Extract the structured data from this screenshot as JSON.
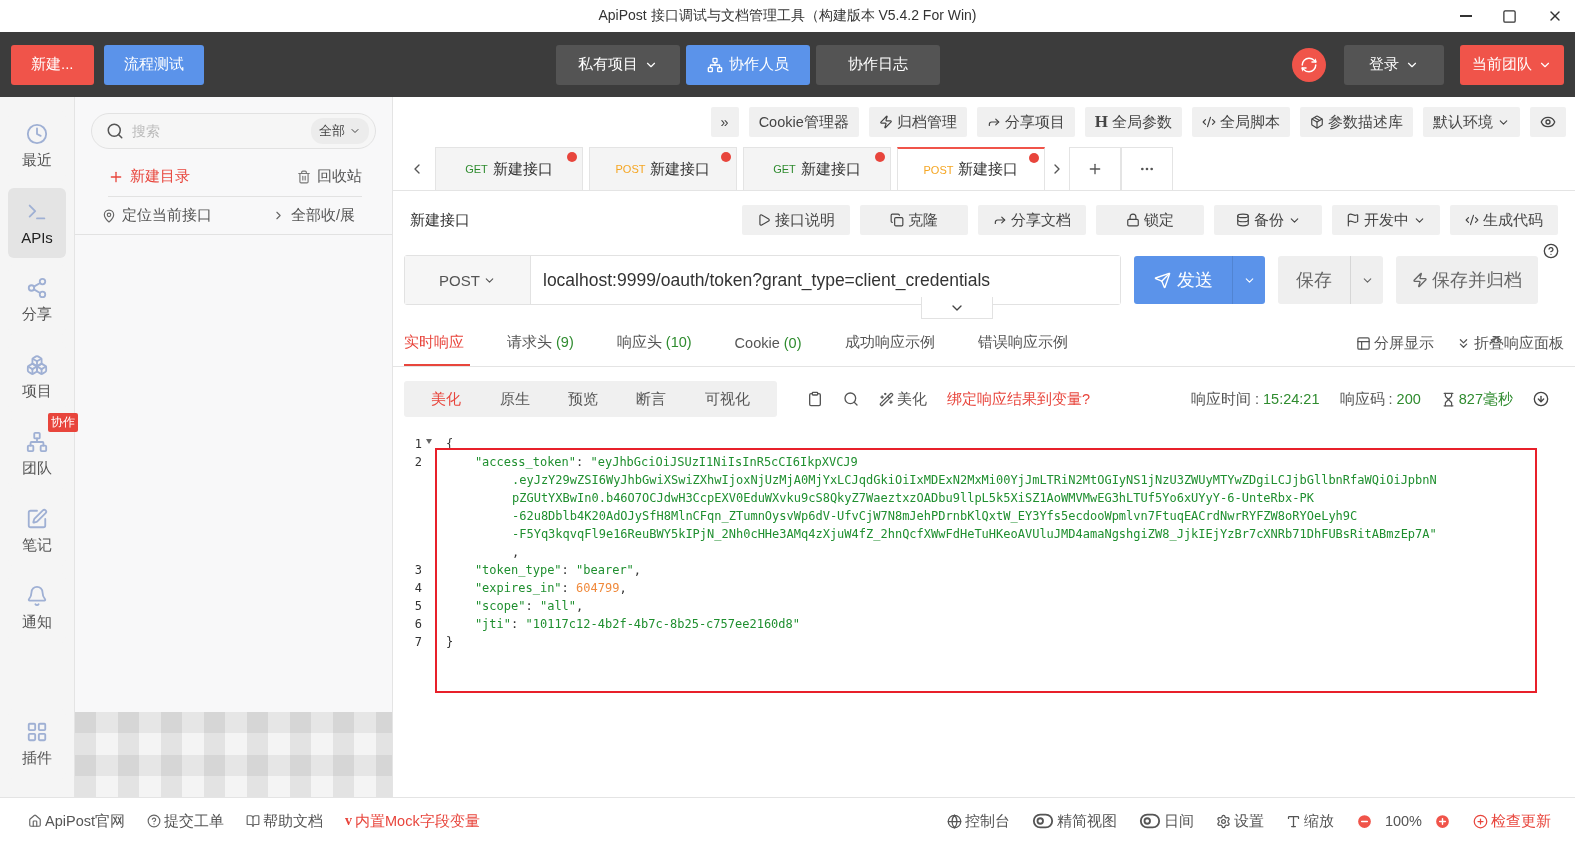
{
  "window": {
    "title": "ApiPost 接口调试与文档管理工具（构建版本 V5.4.2 For Win)"
  },
  "topbar": {
    "left": [
      {
        "label": "新建...",
        "kind": "danger"
      },
      {
        "label": "流程测试",
        "kind": "primary"
      }
    ],
    "center": [
      {
        "label": "私有项目",
        "dropdown": true,
        "selected": false
      },
      {
        "label": "协作人员",
        "dropdown": false,
        "selected": true
      },
      {
        "label": "协作日志",
        "dropdown": false,
        "selected": false
      }
    ],
    "login": "登录",
    "team": "当前团队"
  },
  "rail": [
    {
      "label": "最近",
      "selected": false
    },
    {
      "label": "APIs",
      "selected": true
    },
    {
      "label": "分享",
      "selected": false
    },
    {
      "label": "项目",
      "selected": false
    },
    {
      "label": "团队",
      "selected": false,
      "badge": "协作"
    },
    {
      "label": "笔记",
      "selected": false
    },
    {
      "label": "通知",
      "selected": false
    },
    {
      "label": "插件",
      "selected": false
    }
  ],
  "panel": {
    "search": {
      "placeholder": "搜索",
      "scope": "全部"
    },
    "new_folder": "新建目录",
    "recycle": "回收站",
    "locate": "定位当前接口",
    "collapse": "全部收/展"
  },
  "toolbar": [
    {
      "label": "»"
    },
    {
      "label": "Cookie管理器"
    },
    {
      "label": "归档管理"
    },
    {
      "label": "分享项目"
    },
    {
      "label": "全局参数",
      "glyph": "H"
    },
    {
      "label": "全局脚本"
    },
    {
      "label": "参数描述库"
    },
    {
      "label": "默认环境",
      "dropdown": true
    }
  ],
  "tabs": [
    {
      "method": "GET",
      "kind": "get",
      "label": "新建接口",
      "selected": false,
      "unsaved": true
    },
    {
      "method": "POST",
      "kind": "post",
      "label": "新建接口",
      "selected": false,
      "unsaved": true
    },
    {
      "method": "GET",
      "kind": "get",
      "label": "新建接口",
      "selected": false,
      "unsaved": true
    },
    {
      "method": "POST",
      "kind": "post",
      "label": "新建接口",
      "selected": true,
      "unsaved": true
    }
  ],
  "request": {
    "name": "新建接口",
    "actions": [
      {
        "label": "接口说明"
      },
      {
        "label": "克隆"
      },
      {
        "label": "分享文档"
      },
      {
        "label": "锁定"
      },
      {
        "label": "备份",
        "dropdown": true
      },
      {
        "label": "开发中",
        "dropdown": true
      },
      {
        "label": "生成代码"
      }
    ],
    "method": "POST",
    "url": "localhost:9999/oauth/token?grant_type=client_credentials",
    "send": "发送",
    "save": "保存",
    "save_archive": "保存并归档"
  },
  "response": {
    "tabs": [
      {
        "label": "实时响应",
        "selected": true
      },
      {
        "label": "请求头",
        "count": "(9)",
        "selected": false
      },
      {
        "label": "响应头",
        "count": "(10)",
        "selected": false
      },
      {
        "label": "Cookie",
        "count": "(0)",
        "selected": false
      },
      {
        "label": "成功响应示例",
        "selected": false
      },
      {
        "label": "错误响应示例",
        "selected": false
      }
    ],
    "split": "分屏显示",
    "fold": "折叠响应面板",
    "views": [
      {
        "label": "美化",
        "selected": true
      },
      {
        "label": "原生",
        "selected": false
      },
      {
        "label": "预览",
        "selected": false
      },
      {
        "label": "断言",
        "selected": false
      },
      {
        "label": "可视化",
        "selected": false
      }
    ],
    "beautify": "美化",
    "bind": "绑定响应结果到变量?",
    "time_label": "响应时间 :",
    "time": "15:24:21",
    "code_label": "响应码 :",
    "code": "200",
    "duration": "827毫秒"
  },
  "code": [
    {
      "number": "1",
      "tokens": [
        {
          "kind": "punct",
          "text": "{"
        }
      ],
      "fold": true
    },
    {
      "number": "2",
      "tokens": [
        {
          "kind": "key",
          "text": "    \"access_token\""
        },
        {
          "kind": "punct",
          "text": ": "
        },
        {
          "kind": "string",
          "text": "\"eyJhbGciOiJSUzI1NiIsInR5cCI6IkpXVCJ9"
        }
      ],
      "wrap": [
        {
          "kind": "string",
          "text": ".eyJzY29wZSI6WyJhbGwiXSwiZXhwIjoxNjUzMjA0MjYxLCJqdGkiOiIxMDExN2MxMi00YjJmLTRiN2MtOGIyNS1jNzU3ZWUyMTYwZDgiLCJjbGllbnRfaWQiOiJpbnN"
        },
        {
          "kind": "string",
          "text": "pZGUtYXBwIn0.b46O7OCJdwH3CcpEXV0EduWXvku9cS8QkyZ7WaeztxzOADbu9llpL5k5XiSZ1AoWMVMwEG3hLTUf5Yo6xUYyY-6-UnteRbx-PK"
        },
        {
          "kind": "string",
          "text": "-62u8Dblb4K20AdOJySfH8MlnCFqn_ZTumnOysvWp6dV-UfvCjW7N8mJehPDrnbKlQxtW_EY3Yfs5ecdooWpmlvn7FtuqEACrdNwrRYFZW8oRYOeLyh9C"
        },
        {
          "kind": "string",
          "text": "-F5Yq3kqvqFl9e16ReuBWY5kIPjN_2Nh0cHHe3AMq4zXjuW4fZ_2hnQcfXWwFdHeTuHKeoAVUluJMD4amaNgshgiZW8_JjkIEjYzBr7cXNRb71DhFUBsRitABmzEp7A\""
        },
        {
          "kind": "punct",
          "text": ","
        }
      ]
    },
    {
      "number": "3",
      "tokens": [
        {
          "kind": "key",
          "text": "    \"token_type\""
        },
        {
          "kind": "punct",
          "text": ": "
        },
        {
          "kind": "string",
          "text": "\"bearer\""
        },
        {
          "kind": "punct",
          "text": ","
        }
      ]
    },
    {
      "number": "4",
      "tokens": [
        {
          "kind": "key",
          "text": "    \"expires_in\""
        },
        {
          "kind": "punct",
          "text": ": "
        },
        {
          "kind": "number",
          "text": "604799"
        },
        {
          "kind": "punct",
          "text": ","
        }
      ]
    },
    {
      "number": "5",
      "tokens": [
        {
          "kind": "key",
          "text": "    \"scope\""
        },
        {
          "kind": "punct",
          "text": ": "
        },
        {
          "kind": "string",
          "text": "\"all\""
        },
        {
          "kind": "punct",
          "text": ","
        }
      ]
    },
    {
      "number": "6",
      "tokens": [
        {
          "kind": "key",
          "text": "    \"jti\""
        },
        {
          "kind": "punct",
          "text": ": "
        },
        {
          "kind": "string",
          "text": "\"10117c12-4b2f-4b7c-8b25-c757ee2160d8\""
        }
      ]
    },
    {
      "number": "7",
      "tokens": [
        {
          "kind": "punct",
          "text": "}"
        }
      ]
    }
  ],
  "status": {
    "left": [
      {
        "label": "ApiPost官网",
        "kind": "plain"
      },
      {
        "label": "提交工单",
        "kind": "plain"
      },
      {
        "label": "帮助文档",
        "kind": "plain"
      },
      {
        "label": "内置Mock字段变量",
        "kind": "alert",
        "glyph": "v"
      }
    ],
    "right": [
      {
        "label": "控制台",
        "kind": "plain"
      },
      {
        "label": "精简视图",
        "kind": "toggle",
        "on": false
      },
      {
        "label": "日间",
        "kind": "toggle",
        "on": false
      },
      {
        "label": "设置",
        "kind": "plain"
      },
      {
        "label": "缩放",
        "kind": "plain"
      },
      {
        "label": "100%",
        "kind": "zoom"
      },
      {
        "label": "检查更新",
        "kind": "alert"
      }
    ]
  }
}
